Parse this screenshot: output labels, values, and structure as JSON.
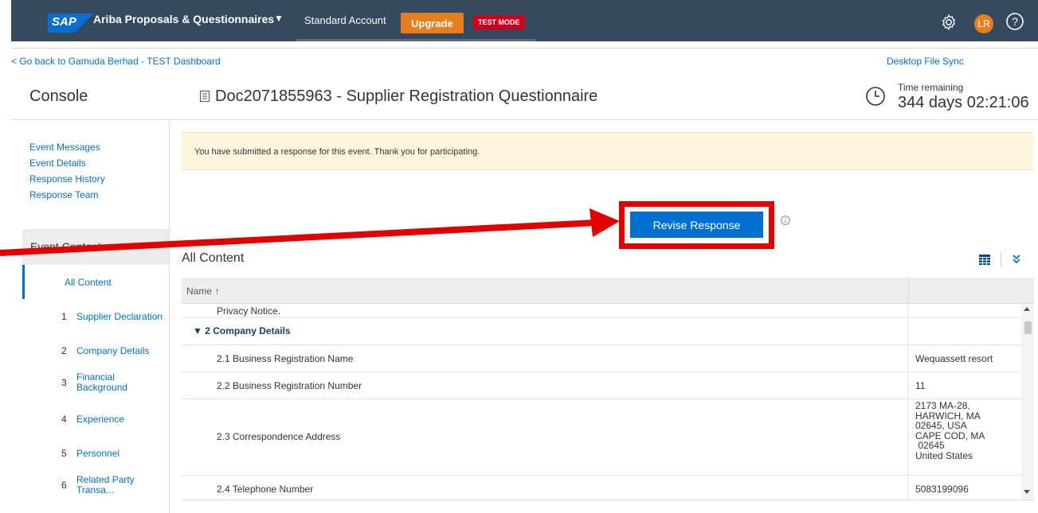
{
  "topbar": {
    "logo": "SAP",
    "app_name": "Ariba Proposals & Questionnaires",
    "app_menu_icon": "chevron-down-icon",
    "account": "Standard Account",
    "upgrade_label": "Upgrade",
    "test_mode": "TEST MODE",
    "avatar_initials": "LR"
  },
  "breadcrumb": {
    "back_link": "< Go back to Gamuda Berhad - TEST Dashboard",
    "desktop_sync": "Desktop File Sync"
  },
  "header": {
    "console_title": "Console",
    "doc_title": "Doc2071855963 - Supplier Registration Questionnaire",
    "time_label": "Time remaining",
    "time_value": "344 days 02:21:06"
  },
  "nav": {
    "links": [
      "Event Messages",
      "Event Details",
      "Response History",
      "Response Team"
    ],
    "event_contents": "Event Contents",
    "contents": [
      {
        "num": "",
        "label": "All Content"
      },
      {
        "num": "1",
        "label": "Supplier Declaration"
      },
      {
        "num": "2",
        "label": "Company Details"
      },
      {
        "num": "3",
        "label": "Financial Background"
      },
      {
        "num": "4",
        "label": "Experience"
      },
      {
        "num": "5",
        "label": "Personnel"
      },
      {
        "num": "6",
        "label": "Related Party Transa..."
      }
    ]
  },
  "banner": {
    "message": "You have submitted a response for this event.  Thank you for participating."
  },
  "revise": {
    "label": "Revise Response"
  },
  "all_content": {
    "title": "All Content",
    "column_name": "Name ↑",
    "rows": [
      {
        "name": "Privacy Notice.",
        "value": ""
      },
      {
        "name": "▼ 2  Company Details",
        "value": ""
      },
      {
        "name": "2.1  Business Registration Name",
        "value": "Wequassett resort"
      },
      {
        "name": "2.2  Business Registration Number",
        "value": "11"
      },
      {
        "name": "2.3  Correspondence Address",
        "value": "2173 MA-28,\nHARWICH, MA\n02645, USA\nCAPE COD, MA\n 02645\nUnited States"
      },
      {
        "name": "2.4  Telephone Number",
        "value": "5083199096"
      }
    ]
  },
  "colors": {
    "topbar": "#354a5f",
    "link": "#0070d2",
    "primary_button": "#0070d2",
    "upgrade": "#e87d1e",
    "test_mode": "#d0021b",
    "highlight_annotation": "#e30000",
    "banner_bg": "#fdf5de"
  }
}
